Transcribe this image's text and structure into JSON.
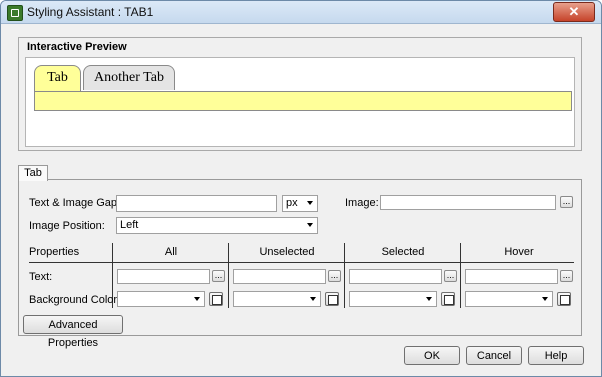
{
  "window": {
    "title": "Styling Assistant : TAB1",
    "close_glyph": "✕"
  },
  "preview": {
    "group_title": "Interactive Preview",
    "tabs": [
      "Tab",
      "Another Tab"
    ]
  },
  "tab_strip": {
    "label": "Tab"
  },
  "form": {
    "text_image_gap_label": "Text & Image Gap:",
    "text_image_gap_value": "",
    "unit_value": "px",
    "image_label": "Image:",
    "image_value": "",
    "image_position_label": "Image Position:",
    "image_position_value": "Left",
    "browse_glyph": "..."
  },
  "properties": {
    "header": "Properties",
    "columns": [
      "All",
      "Unselected",
      "Selected",
      "Hover"
    ],
    "rows": [
      {
        "label": "Text:"
      },
      {
        "label": "Background Color:"
      }
    ]
  },
  "buttons": {
    "advanced": "Advanced Properties",
    "ok": "OK",
    "cancel": "Cancel",
    "help": "Help"
  },
  "colors": {
    "preview_tab_yellow": "#ffff99"
  }
}
